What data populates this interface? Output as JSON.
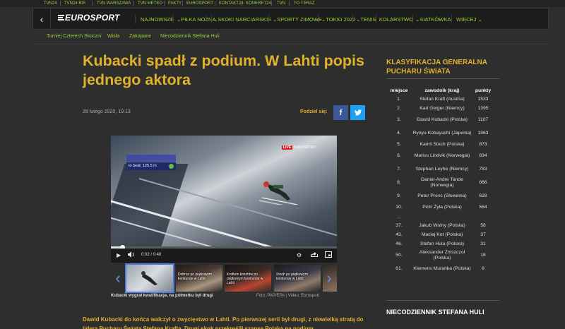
{
  "topbar": [
    "TVN24",
    "TVN24 BIS",
    "TVN WARSZAWA",
    "TVN METEO",
    "FAKTY",
    "EUROSPORT",
    "KONTAKT24",
    "KONKRET24",
    "TVN",
    "TO TERAZ"
  ],
  "nav": {
    "logo": "EUROSPORT",
    "items": [
      "NAJNOWSZE",
      "PIŁKA NOŻNA",
      "SKOKI NARCIARSKIE",
      "SPORTY ZIMOWE",
      "TOKIO 2020",
      "TENIS",
      "KOLARSTWO",
      "SIATKÓWKA",
      "WIĘCEJ"
    ],
    "chevrons": [
      "",
      "⌄",
      "⌄",
      "⌄",
      "⌄",
      "⌄",
      "",
      "⌄",
      ""
    ]
  },
  "breadcrumbs": [
    "Turniej Czterech Skoczni",
    "Wisła",
    "Zakopane",
    "Niecodziennik Stefana Huli"
  ],
  "article": {
    "title": "Kubacki spadł z podium. W Lahti popis jednego aktora",
    "date": "28 lutego 2020, 19:13",
    "share_label": "Podziel się:",
    "video": {
      "overlay_text": "to beat: 125.5 m",
      "live_badge": "LIVE",
      "channel": "EUROSPORT",
      "time": "0:02 / 0:48",
      "progress": 0.05,
      "caption": "Kubacki wygrał kwalifikacje, na półmetku był drugi",
      "source": "Foto: PAP/EPA | Video: Eurosport"
    },
    "thumbnails": [
      "",
      "Dobrze po piątkowym konkursie w Lahti",
      "Kraftem kosztów po piątkowym konkursie w Lahti",
      "Stoch po piątkowym konkursie w Lahti",
      ""
    ],
    "lead": "Dawid Kubacki do końca walczył o zwycięstwo w Lahti. Po pierwszej serii był drugi, z niewielką stratą do lidera Pucharu Świata Stefana Krafta. Drugi skok przekreślił szanse Polaka na podium."
  },
  "sidebar": {
    "title": "Klasyfikacja generalna Pucharu Świata",
    "headers": [
      "miejsce",
      "zawodnik (kraj)",
      "punkty"
    ],
    "rows": [
      {
        "pos": "1.",
        "name": "Stefan Kraft (Austria)",
        "pts": "1533"
      },
      {
        "pos": "2.",
        "name": "Karl Geiger (Niemcy)",
        "pts": "1395"
      },
      {
        "pos": "3.",
        "name": "Dawid Kubacki (Polska)",
        "pts": "1107"
      },
      {
        "pos": "4.",
        "name": "Ryoyu Kobayashi (Japonia)",
        "pts": "1063"
      },
      {
        "pos": "5.",
        "name": "Kamil Stoch (Polska)",
        "pts": "873"
      },
      {
        "pos": "6.",
        "name": "Marius Lindvik (Norwegia)",
        "pts": "834"
      },
      {
        "pos": "7.",
        "name": "Stephan Leyhe (Niemcy)",
        "pts": "783"
      },
      {
        "pos": "8.",
        "name": "Daniel-Andre Tande (Norwegia)",
        "pts": "666"
      },
      {
        "pos": "9.",
        "name": "Peter Prevc (Słowenia)",
        "pts": "628"
      },
      {
        "pos": "10.",
        "name": "Piotr Żyła (Polska)",
        "pts": "564"
      },
      {
        "pos": "...",
        "name": "",
        "pts": ""
      },
      {
        "pos": "37.",
        "name": "Jakub Wolny (Polska)",
        "pts": "58"
      },
      {
        "pos": "43.",
        "name": "Maciej Kot (Polska)",
        "pts": "37"
      },
      {
        "pos": "46.",
        "name": "Stefan Hula (Polska)",
        "pts": "31"
      },
      {
        "pos": "50.",
        "name": "Aleksander Zniszczoł (Polska)",
        "pts": "18"
      },
      {
        "pos": "61.",
        "name": "Klemens Murańka (Polska)",
        "pts": "8"
      }
    ],
    "section2_title": "Niecodziennik Stefana Huli"
  },
  "colors": {
    "background": "#2e2e2e",
    "accent_green": "#9bd13a",
    "accent_gold": "#e0b12b",
    "facebook": "#3b5998",
    "twitter": "#1da1f2"
  }
}
